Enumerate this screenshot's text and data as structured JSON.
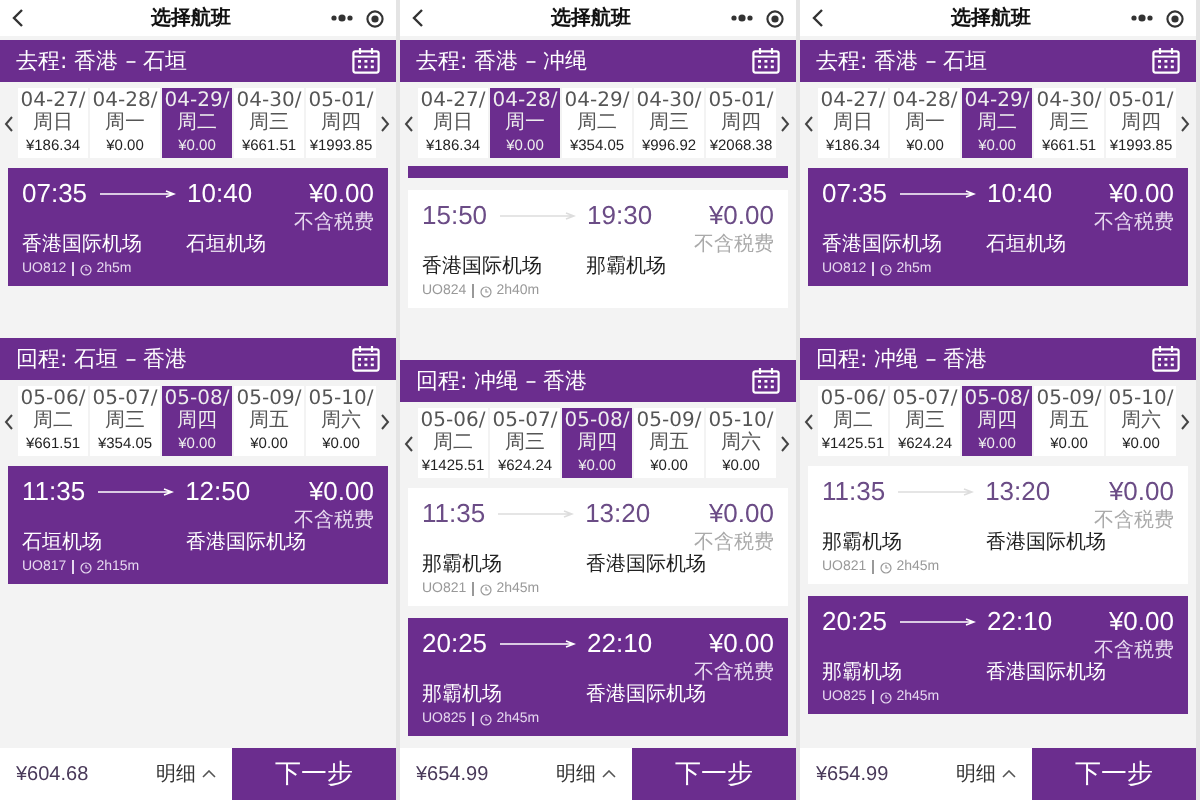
{
  "panels": [
    {
      "nav": {
        "title": "选择航班"
      },
      "sections": [
        {
          "heading": "去程: 香港 – 石垣",
          "clipped_bar": false,
          "dates": [
            {
              "date": "04-27/周日",
              "price": "¥186.34",
              "selected": false
            },
            {
              "date": "04-28/周一",
              "price": "¥0.00",
              "selected": false
            },
            {
              "date": "04-29/周二",
              "price": "¥0.00",
              "selected": true
            },
            {
              "date": "04-30/周三",
              "price": "¥661.51",
              "selected": false
            },
            {
              "date": "05-01/周四",
              "price": "¥1993.85",
              "selected": false
            }
          ],
          "flights": [
            {
              "dep_time": "07:35",
              "arr_time": "10:40",
              "price": "¥0.00",
              "tax_note": "不含税费",
              "dep_airport": "香港国际机场",
              "arr_airport": "石垣机场",
              "flight_no": "UO812",
              "duration": "2h5m",
              "selected": true
            }
          ]
        },
        {
          "heading": "回程: 石垣 – 香港",
          "clipped_bar": false,
          "dates": [
            {
              "date": "05-06/周二",
              "price": "¥661.51",
              "selected": false
            },
            {
              "date": "05-07/周三",
              "price": "¥354.05",
              "selected": false
            },
            {
              "date": "05-08/周四",
              "price": "¥0.00",
              "selected": true
            },
            {
              "date": "05-09/周五",
              "price": "¥0.00",
              "selected": false
            },
            {
              "date": "05-10/周六",
              "price": "¥0.00",
              "selected": false
            }
          ],
          "flights": [
            {
              "dep_time": "11:35",
              "arr_time": "12:50",
              "price": "¥0.00",
              "tax_note": "不含税费",
              "dep_airport": "石垣机场",
              "arr_airport": "香港国际机场",
              "flight_no": "UO817",
              "duration": "2h15m",
              "selected": true
            }
          ]
        }
      ],
      "footer": {
        "total": "¥604.68",
        "details": "明细",
        "next": "下一步"
      }
    },
    {
      "nav": {
        "title": "选择航班"
      },
      "sections": [
        {
          "heading": "去程: 香港 – 冲绳",
          "clipped_bar": true,
          "dates": [
            {
              "date": "04-27/周日",
              "price": "¥186.34",
              "selected": false
            },
            {
              "date": "04-28/周一",
              "price": "¥0.00",
              "selected": true
            },
            {
              "date": "04-29/周二",
              "price": "¥354.05",
              "selected": false
            },
            {
              "date": "04-30/周三",
              "price": "¥996.92",
              "selected": false
            },
            {
              "date": "05-01/周四",
              "price": "¥2068.38",
              "selected": false
            }
          ],
          "flights": [
            {
              "dep_time": "15:50",
              "arr_time": "19:30",
              "price": "¥0.00",
              "tax_note": "不含税费",
              "dep_airport": "香港国际机场",
              "arr_airport": "那霸机场",
              "flight_no": "UO824",
              "duration": "2h40m",
              "selected": false
            }
          ]
        },
        {
          "heading": "回程: 冲绳 – 香港",
          "clipped_bar": false,
          "dates": [
            {
              "date": "05-06/周二",
              "price": "¥1425.51",
              "selected": false
            },
            {
              "date": "05-07/周三",
              "price": "¥624.24",
              "selected": false
            },
            {
              "date": "05-08/周四",
              "price": "¥0.00",
              "selected": true
            },
            {
              "date": "05-09/周五",
              "price": "¥0.00",
              "selected": false
            },
            {
              "date": "05-10/周六",
              "price": "¥0.00",
              "selected": false
            }
          ],
          "flights": [
            {
              "dep_time": "11:35",
              "arr_time": "13:20",
              "price": "¥0.00",
              "tax_note": "不含税费",
              "dep_airport": "那霸机场",
              "arr_airport": "香港国际机场",
              "flight_no": "UO821",
              "duration": "2h45m",
              "selected": false
            },
            {
              "dep_time": "20:25",
              "arr_time": "22:10",
              "price": "¥0.00",
              "tax_note": "不含税费",
              "dep_airport": "那霸机场",
              "arr_airport": "香港国际机场",
              "flight_no": "UO825",
              "duration": "2h45m",
              "selected": true
            }
          ]
        }
      ],
      "footer": {
        "total": "¥654.99",
        "details": "明细",
        "next": "下一步"
      }
    },
    {
      "nav": {
        "title": "选择航班"
      },
      "sections": [
        {
          "heading": "去程: 香港 – 石垣",
          "clipped_bar": false,
          "dates": [
            {
              "date": "04-27/周日",
              "price": "¥186.34",
              "selected": false
            },
            {
              "date": "04-28/周一",
              "price": "¥0.00",
              "selected": false
            },
            {
              "date": "04-29/周二",
              "price": "¥0.00",
              "selected": true
            },
            {
              "date": "04-30/周三",
              "price": "¥661.51",
              "selected": false
            },
            {
              "date": "05-01/周四",
              "price": "¥1993.85",
              "selected": false
            }
          ],
          "flights": [
            {
              "dep_time": "07:35",
              "arr_time": "10:40",
              "price": "¥0.00",
              "tax_note": "不含税费",
              "dep_airport": "香港国际机场",
              "arr_airport": "石垣机场",
              "flight_no": "UO812",
              "duration": "2h5m",
              "selected": true
            }
          ]
        },
        {
          "heading": "回程: 冲绳 – 香港",
          "clipped_bar": false,
          "dates": [
            {
              "date": "05-06/周二",
              "price": "¥1425.51",
              "selected": false
            },
            {
              "date": "05-07/周三",
              "price": "¥624.24",
              "selected": false
            },
            {
              "date": "05-08/周四",
              "price": "¥0.00",
              "selected": true
            },
            {
              "date": "05-09/周五",
              "price": "¥0.00",
              "selected": false
            },
            {
              "date": "05-10/周六",
              "price": "¥0.00",
              "selected": false
            }
          ],
          "flights": [
            {
              "dep_time": "11:35",
              "arr_time": "13:20",
              "price": "¥0.00",
              "tax_note": "不含税费",
              "dep_airport": "那霸机场",
              "arr_airport": "香港国际机场",
              "flight_no": "UO821",
              "duration": "2h45m",
              "selected": false
            },
            {
              "dep_time": "20:25",
              "arr_time": "22:10",
              "price": "¥0.00",
              "tax_note": "不含税费",
              "dep_airport": "那霸机场",
              "arr_airport": "香港国际机场",
              "flight_no": "UO825",
              "duration": "2h45m",
              "selected": true
            }
          ]
        }
      ],
      "footer": {
        "total": "¥654.99",
        "details": "明细",
        "next": "下一步"
      }
    }
  ]
}
